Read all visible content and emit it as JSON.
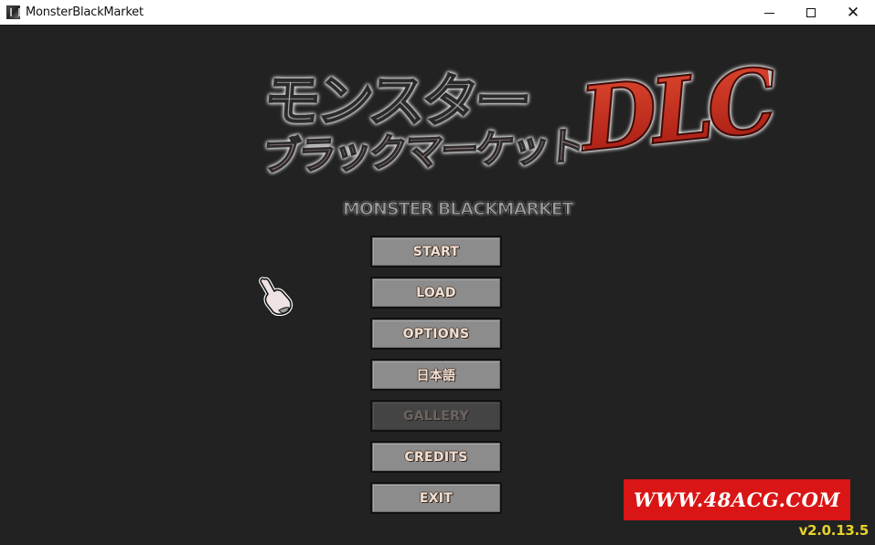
{
  "window": {
    "title": "MonsterBlackMarket",
    "icon": "app-icon",
    "controls": {
      "minimize": "minimize-icon",
      "maximize": "maximize-icon",
      "close": "close-icon"
    }
  },
  "logo": {
    "jp_line1": "モンスター",
    "jp_line2": "ブラックマーケット",
    "dlc": "DLC",
    "en_title": "MONSTER BLACKMARKET"
  },
  "menu": {
    "items": [
      {
        "label": "START",
        "enabled": true
      },
      {
        "label": "LOAD",
        "enabled": true
      },
      {
        "label": "OPTIONS",
        "enabled": true
      },
      {
        "label": "日本語",
        "enabled": true
      },
      {
        "label": "GALLERY",
        "enabled": false
      },
      {
        "label": "CREDITS",
        "enabled": true
      },
      {
        "label": "EXIT",
        "enabled": true
      }
    ]
  },
  "cursor": {
    "icon": "pointing-hand-icon"
  },
  "watermark": {
    "text": "WWW.48ACG.COM",
    "color": "#d91515"
  },
  "version": {
    "text": "v2.0.13.5",
    "color": "#e6d22a"
  }
}
